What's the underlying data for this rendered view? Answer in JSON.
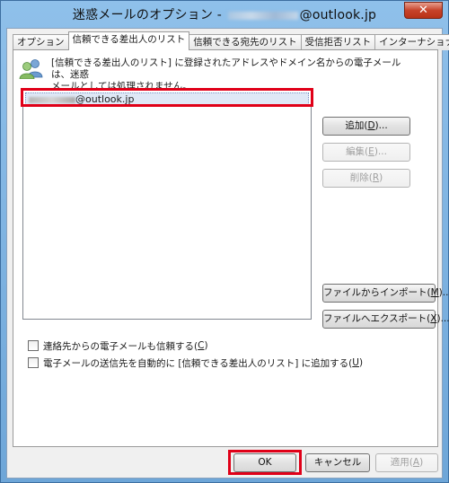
{
  "window": {
    "title_prefix": "迷惑メールのオプション - ",
    "title_suffix": "@outlook.jp",
    "close_label": "✕"
  },
  "tabs": [
    {
      "label": "オプション",
      "active": false
    },
    {
      "label": "信頼できる差出人のリスト",
      "active": true
    },
    {
      "label": "信頼できる宛先のリスト",
      "active": false
    },
    {
      "label": "受信拒否リスト",
      "active": false
    },
    {
      "label": "インターナショナル",
      "active": false
    }
  ],
  "info": {
    "line1": "[信頼できる差出人のリスト] に登録されたアドレスやドメイン名からの電子メールは、迷惑",
    "line2": "メールとしては処理されません。"
  },
  "list": {
    "items": [
      {
        "suffix": "@outlook.jp"
      }
    ]
  },
  "buttons": {
    "add": {
      "text": "追加(",
      "key": "D",
      "end": ")..."
    },
    "edit": {
      "text": "編集(",
      "key": "E",
      "end": ")..."
    },
    "delete": {
      "text": "削除(",
      "key": "R",
      "end": ")"
    },
    "import": {
      "text": "ファイルからインポート(",
      "key": "M",
      "end": ")..."
    },
    "export": {
      "text": "ファイルへエクスポート(",
      "key": "X",
      "end": ")..."
    }
  },
  "checkboxes": [
    {
      "text": "連絡先からの電子メールも信頼する(",
      "key": "C",
      "end": ")",
      "checked": false
    },
    {
      "text": "電子メールの送信先を自動的に [信頼できる差出人のリスト] に追加する(",
      "key": "U",
      "end": ")",
      "checked": false
    }
  ],
  "footer": {
    "ok": "OK",
    "cancel": "キャンセル",
    "apply": {
      "text": "適用(",
      "key": "A",
      "end": ")"
    }
  },
  "colors": {
    "highlight": "#e00018",
    "selection": "#dfe8f6"
  }
}
